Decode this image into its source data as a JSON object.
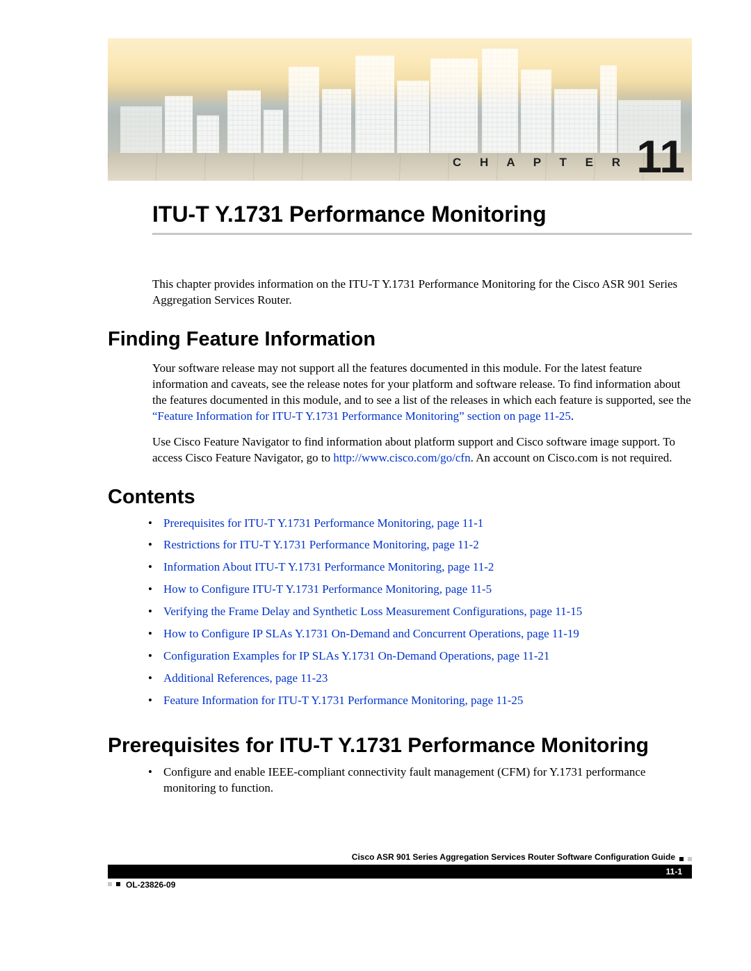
{
  "chapter": {
    "label": "C H A P T E R",
    "number": "11"
  },
  "title": "ITU-T Y.1731 Performance Monitoring",
  "intro": "This chapter provides information on the ITU-T Y.1731 Performance Monitoring for the Cisco ASR 901 Series Aggregation Services Router.",
  "sections": {
    "finding": {
      "heading": "Finding Feature Information",
      "p1a": "Your software release may not support all the features documented in this module. For the latest feature information and caveats, see the release notes for your platform and software release. To find information about the features documented in this module, and to see a list of the releases in which each feature is supported, see the ",
      "p1_link": "“Feature Information for ITU-T Y.1731 Performance Monitoring” section on page 11-25",
      "p1b": ".",
      "p2a": "Use Cisco Feature Navigator to find information about platform support and Cisco software image support. To access Cisco Feature Navigator, go to ",
      "p2_link": "http://www.cisco.com/go/cfn",
      "p2b": ". An account on Cisco.com is not required."
    },
    "contents": {
      "heading": "Contents",
      "items": [
        "Prerequisites for ITU-T Y.1731 Performance Monitoring, page 11-1",
        "Restrictions for ITU-T Y.1731 Performance Monitoring, page 11-2",
        "Information About ITU-T Y.1731 Performance Monitoring, page 11-2",
        "How to Configure ITU-T Y.1731 Performance Monitoring, page 11-5",
        "Verifying the Frame Delay and Synthetic Loss Measurement Configurations, page 11-15",
        "How to Configure IP SLAs Y.1731 On-Demand and Concurrent Operations, page 11-19",
        "Configuration Examples for IP SLAs Y.1731 On-Demand Operations, page 11-21",
        "Additional References, page 11-23",
        "Feature Information for ITU-T Y.1731 Performance Monitoring, page 11-25"
      ]
    },
    "prereq": {
      "heading": "Prerequisites for ITU-T Y.1731 Performance Monitoring",
      "items": [
        "Configure and enable IEEE-compliant connectivity fault management (CFM) for Y.1731 performance monitoring to function."
      ]
    }
  },
  "footer": {
    "guide": "Cisco ASR 901 Series Aggregation Services Router Software Configuration Guide",
    "doc_id": "OL-23826-09",
    "page": "11-1"
  }
}
